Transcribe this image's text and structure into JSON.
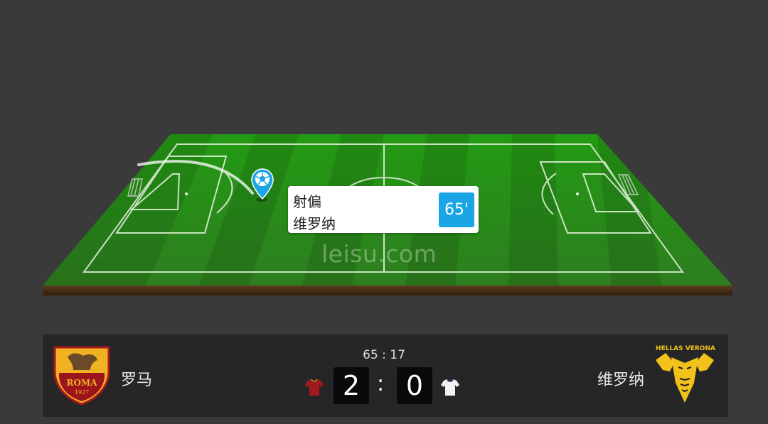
{
  "event": {
    "type": "射偏",
    "team": "维罗纳",
    "minute": "65'"
  },
  "watermark": "leisu.com",
  "match": {
    "clock": "65 : 17",
    "home": {
      "name": "罗马",
      "score": "2",
      "kit_color": "#a11a1c",
      "crest_text": "ROMA",
      "crest_year": "1927"
    },
    "away": {
      "name": "维罗纳",
      "score": "0",
      "kit_color": "#f2f2f2",
      "crest_text": "HELLAS VERONA"
    }
  },
  "icons": {
    "ball_marker": "football-location-pin-icon",
    "home_kit": "jersey-icon",
    "away_kit": "jersey-icon"
  },
  "colors": {
    "pitch": "#2b8a1c",
    "accent": "#1aa6e6",
    "background": "#3a3a3a",
    "scorebar": "#262626"
  }
}
